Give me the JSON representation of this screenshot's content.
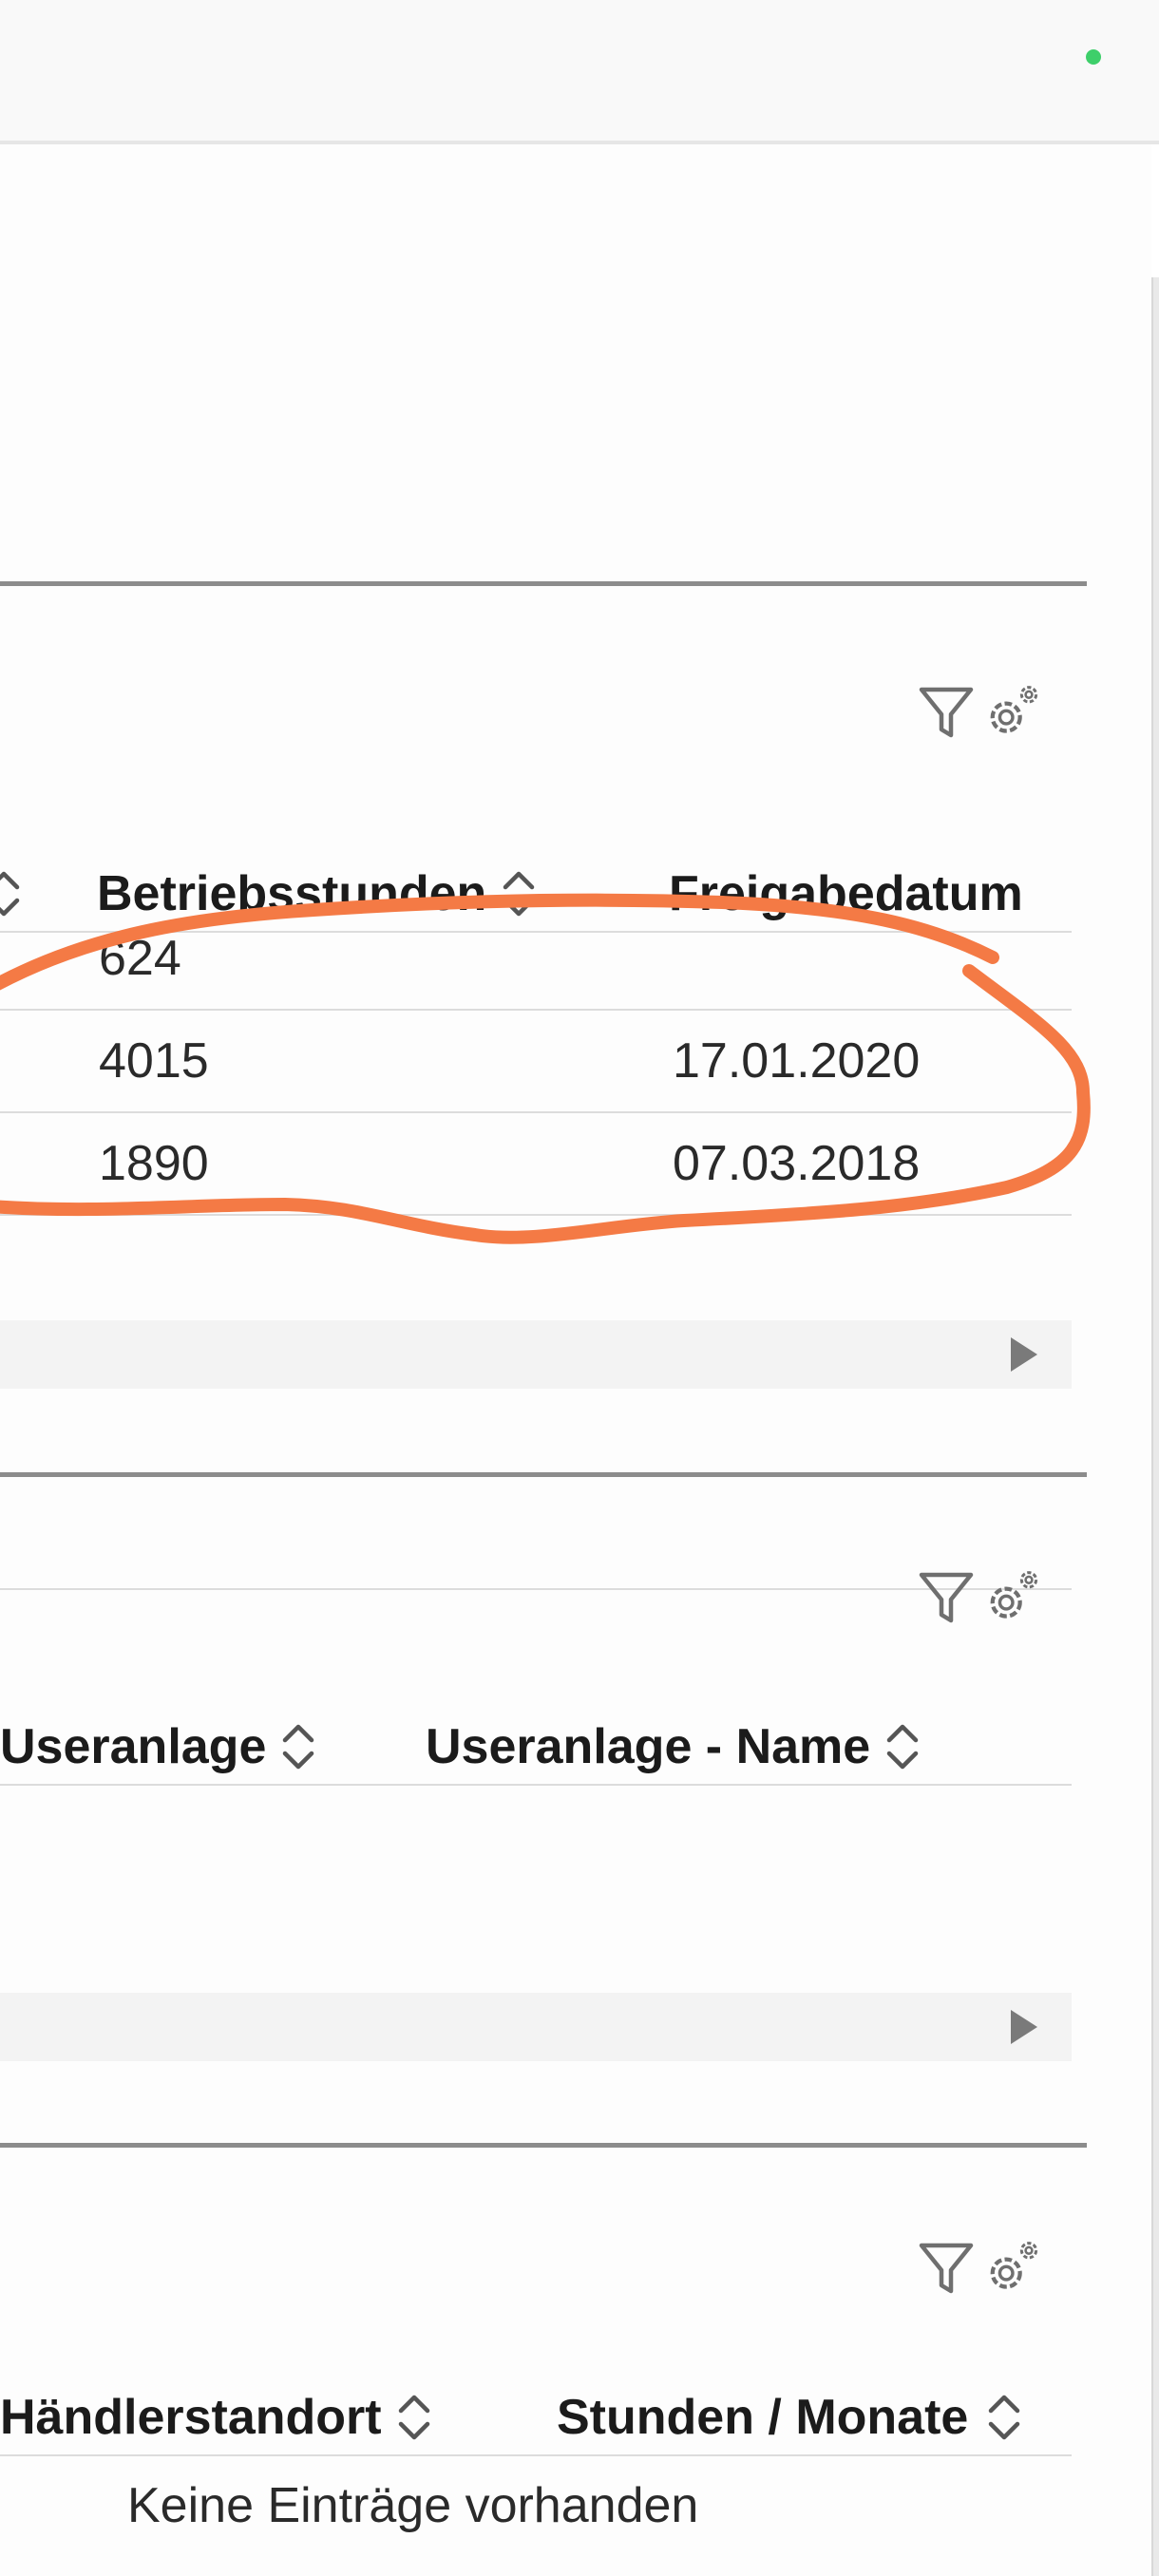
{
  "colors": {
    "status_dot": "#3ecf6a",
    "annotation_stroke": "#f47a45",
    "icon": "#6f6f6f"
  },
  "icons": {
    "filter": "filter-icon",
    "settings": "gear-icon",
    "sort": "sort-icon",
    "pager_next": "play-right-icon"
  },
  "table1": {
    "headers": [
      "Betriebsstunden",
      "Freigabedatum"
    ],
    "rows": [
      {
        "betriebsstunden": "624",
        "freigabedatum": ""
      },
      {
        "betriebsstunden": "4015",
        "freigabedatum": "17.01.2020"
      },
      {
        "betriebsstunden": "1890",
        "freigabedatum": "07.03.2018"
      }
    ]
  },
  "table2": {
    "headers": [
      "Useranlage",
      "Useranlage - Name"
    ],
    "rows": []
  },
  "table3": {
    "headers": [
      "Händlerstandort",
      "Stunden / Monate"
    ],
    "empty_message": "Keine Einträge vorhanden"
  }
}
